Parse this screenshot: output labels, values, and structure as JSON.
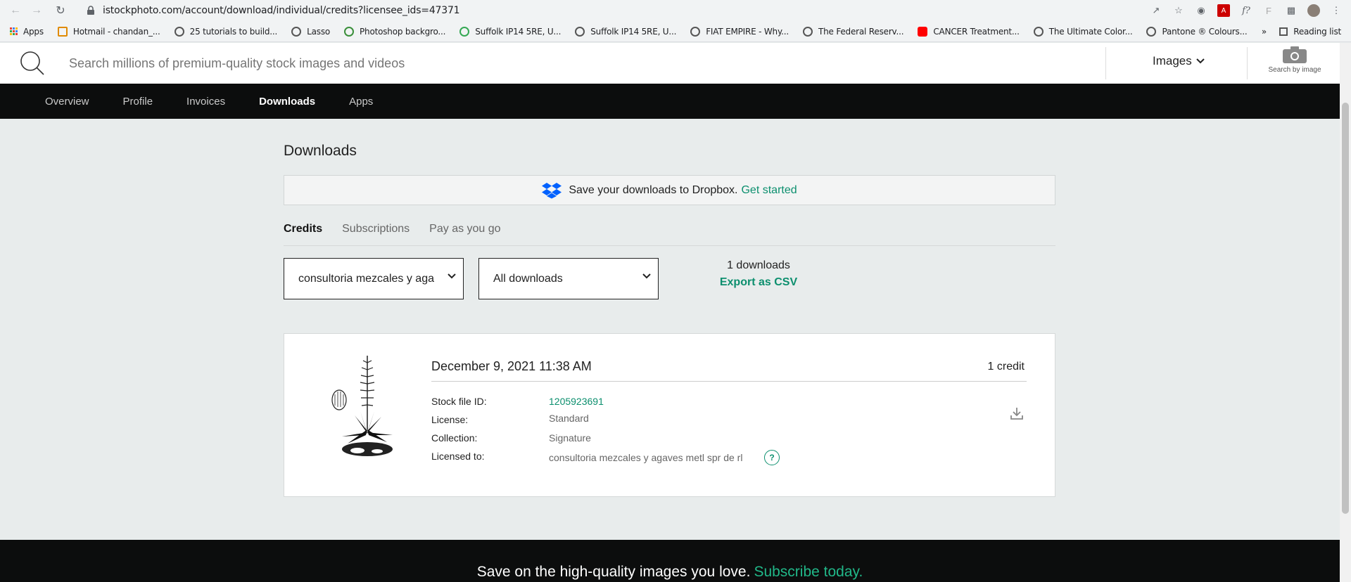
{
  "browser": {
    "url": "istockphoto.com/account/download/individual/credits?licensee_ids=47371",
    "bookmarks": [
      "Apps",
      "Hotmail - chandan_...",
      "25 tutorials to build...",
      "Lasso",
      "Photoshop backgro...",
      "Suffolk IP14 5RE, U...",
      "Suffolk IP14 5RE, U...",
      "FIAT EMPIRE - Why...",
      "The Federal Reserv...",
      "CANCER Treatment...",
      "The Ultimate Color...",
      "Pantone ® Colours..."
    ],
    "reading_list": "Reading list",
    "more": "»"
  },
  "search": {
    "placeholder": "Search millions of premium-quality stock images and videos",
    "type_label": "Images",
    "search_by_image": "Search by image"
  },
  "account_nav": {
    "items": [
      "Overview",
      "Profile",
      "Invoices",
      "Downloads",
      "Apps"
    ],
    "active": "Downloads"
  },
  "page": {
    "title": "Downloads",
    "dropbox_text": "Save your downloads to Dropbox.",
    "dropbox_link": "Get started",
    "tabs": [
      "Credits",
      "Subscriptions",
      "Pay as you go"
    ],
    "active_tab": "Credits",
    "licensee_select": "consultoria mezcales y aga",
    "filter_select": "All downloads",
    "download_count": "1 downloads",
    "export_csv": "Export as CSV"
  },
  "download_item": {
    "date": "December 9, 2021 11:38 AM",
    "credit": "1 credit",
    "labels": {
      "stock_file_id": "Stock file ID:",
      "license": "License:",
      "collection": "Collection:",
      "licensed_to": "Licensed to:"
    },
    "stock_file_id": "1205923691",
    "license": "Standard",
    "collection": "Signature",
    "licensed_to": "consultoria mezcales y agaves metl spr de rl",
    "help": "?"
  },
  "footer": {
    "text": "Save on the high-quality images you love.",
    "link": "Subscribe today."
  },
  "colors": {
    "accent": "#0c8f6e",
    "nav_bg": "#0c0d0d",
    "page_bg": "#e8ecec"
  }
}
